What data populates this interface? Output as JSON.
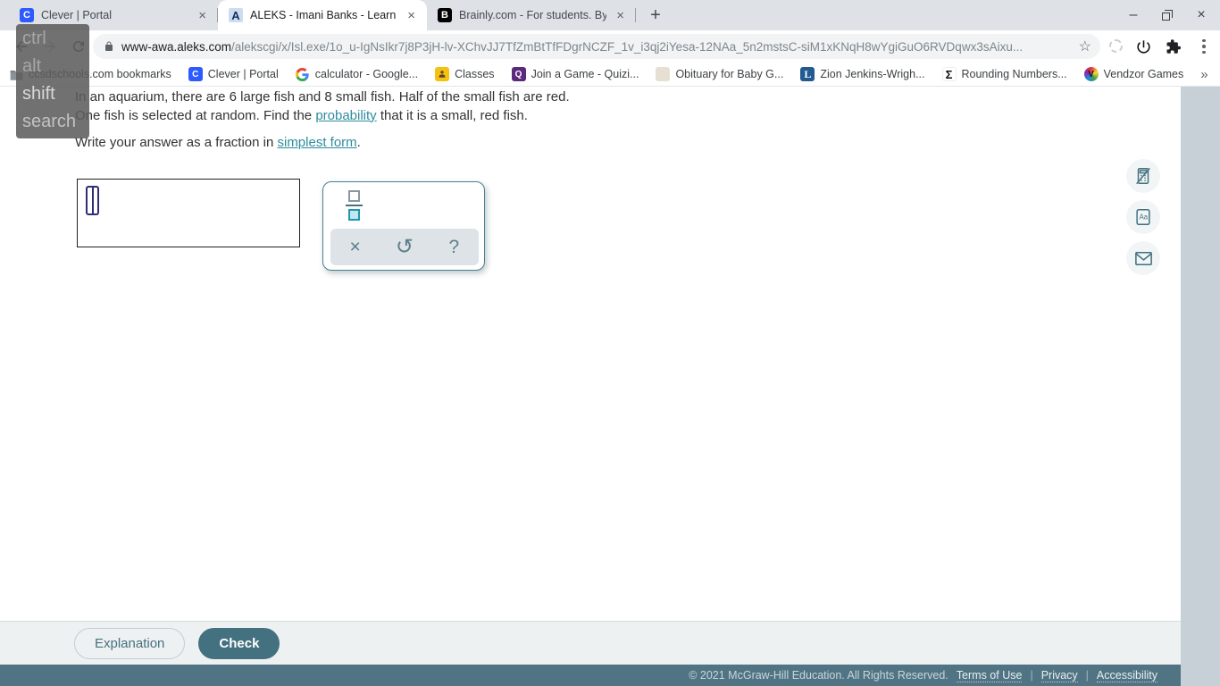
{
  "browser": {
    "tabs": [
      {
        "title": "Clever | Portal",
        "favicon": "C",
        "close": "×"
      },
      {
        "title": "ALEKS - Imani Banks - Learn",
        "favicon": "A",
        "close": "×"
      },
      {
        "title": "Brainly.com - For students. By st",
        "favicon": "B",
        "close": "×"
      }
    ],
    "new_tab": "+",
    "url": {
      "domain": "www-awa.aleks.com",
      "path": "/alekscgi/x/Isl.exe/1o_u-IgNsIkr7j8P3jH-lv-XChvJJ7TfZmBtTfFDgrNCZF_1v_i3qj2iYesa-12NAa_5n2mstsC-siM1xKNqH8wYgiGuO6RVDqwx3sAixu..."
    },
    "star": "☆",
    "bookmarks": [
      {
        "label": "ccsdschools.com bookmarks"
      },
      {
        "label": "Clever | Portal",
        "glyph": "C"
      },
      {
        "label": "calculator - Google..."
      },
      {
        "label": "Classes"
      },
      {
        "label": "Join a Game - Quizi...",
        "glyph": "Q"
      },
      {
        "label": "Obituary for Baby G...",
        "glyph": ""
      },
      {
        "label": "Zion Jenkins-Wrigh...",
        "glyph": "L"
      },
      {
        "label": "Rounding Numbers...",
        "glyph": "Σ"
      },
      {
        "label": "Vendzor Games",
        "glyph": "V"
      }
    ],
    "bookmarks_overflow": "»"
  },
  "sticky_keys": {
    "keys": [
      "ctrl",
      "alt",
      "shift",
      "search"
    ]
  },
  "problem": {
    "line1": "In an aquarium, there are 6 large fish and 8 small fish. Half of the small fish are red.",
    "line2_pre": "One fish is selected at random. Find the ",
    "line2_link": "probability",
    "line2_post": " that it is a small, red fish.",
    "line3_pre": "Write your answer as a fraction in ",
    "line3_link": "simplest form",
    "line3_post": "."
  },
  "palette": {
    "close": "×",
    "undo": "↺",
    "help": "?"
  },
  "action_bar": {
    "explanation": "Explanation",
    "check": "Check"
  },
  "footer": {
    "copyright": "© 2021 McGraw-Hill Education. All Rights Reserved.",
    "link_terms": "Terms of Use",
    "link_privacy": "Privacy",
    "link_accessibility": "Accessibility",
    "separator": "|"
  },
  "colors": {
    "aleks_teal": "#44717f",
    "link_teal": "#2e8d9d",
    "footer_bg": "#517484",
    "side_band": "#c6d0d6"
  }
}
